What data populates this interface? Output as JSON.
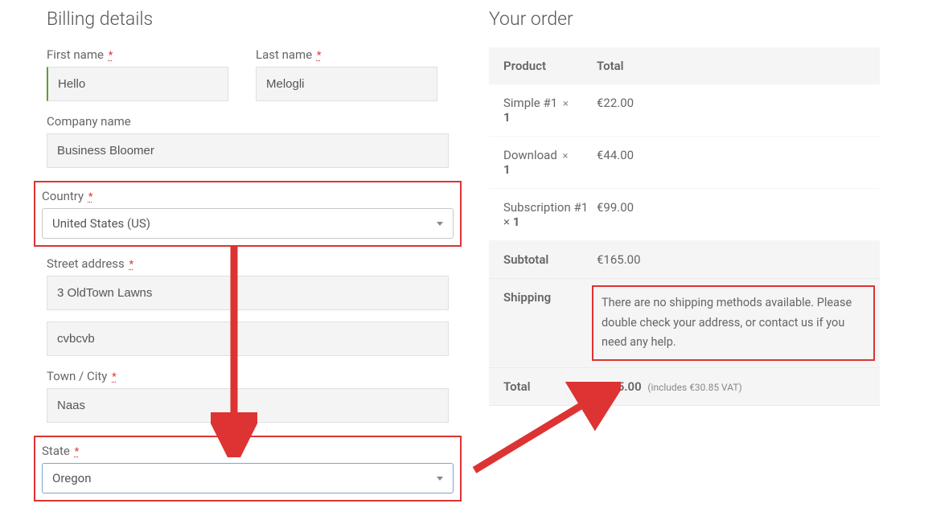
{
  "billing": {
    "heading": "Billing details",
    "first_name_label": "First name",
    "first_name_value": "Hello",
    "last_name_label": "Last name",
    "last_name_value": "Melogli",
    "company_label": "Company name",
    "company_value": "Business Bloomer",
    "country_label": "Country",
    "country_value": "United States (US)",
    "street_label": "Street address",
    "street_value1": "3 OldTown Lawns",
    "street_value2": "cvbcvb",
    "city_label": "Town / City",
    "city_value": "Naas",
    "state_label": "State",
    "state_value": "Oregon"
  },
  "order": {
    "heading": "Your order",
    "header_product": "Product",
    "header_total": "Total",
    "items": [
      {
        "name": "Simple #1",
        "remove": "×",
        "qty": "1",
        "total": "€22.00"
      },
      {
        "name": "Download",
        "remove": "×",
        "qty": "1",
        "total": "€44.00"
      },
      {
        "name": "Subscription #1",
        "remove": "",
        "qty_prefix": "× ",
        "qty": "1",
        "total": "€99.00"
      }
    ],
    "subtotal_label": "Subtotal",
    "subtotal_value": "€165.00",
    "shipping_label": "Shipping",
    "shipping_message": "There are no shipping methods available. Please double check your address, or contact us if you need any help.",
    "total_label": "Total",
    "total_value": "€165.00",
    "vat_note": "(includes €30.85 VAT)"
  },
  "required_marker": "*"
}
